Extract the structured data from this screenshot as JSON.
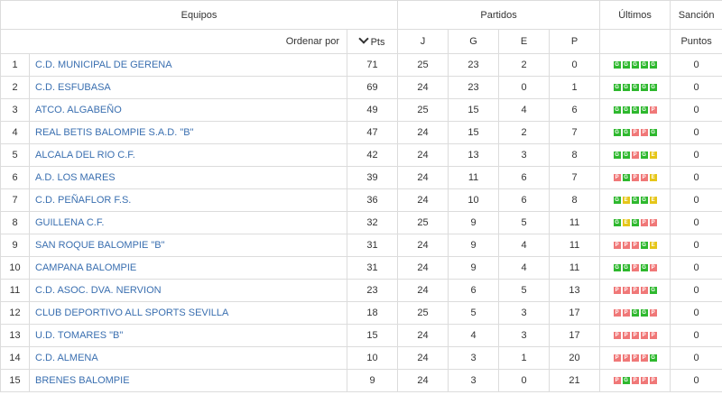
{
  "header": {
    "equipos": "Equipos",
    "partidos": "Partidos",
    "ultimos": "Últimos",
    "sancion": "Sanción",
    "ordenar_por": "Ordenar por",
    "pts": "Pts",
    "j": "J",
    "g": "G",
    "e": "E",
    "p": "P",
    "puntos": "Puntos"
  },
  "rows": [
    {
      "pos": "1",
      "team": "C.D. MUNICIPAL DE GERENA",
      "pts": "71",
      "j": "25",
      "g": "23",
      "e": "2",
      "p": "0",
      "last": [
        "G",
        "G",
        "G",
        "G",
        "G"
      ],
      "sancion": "0"
    },
    {
      "pos": "2",
      "team": "C.D. ESFUBASA",
      "pts": "69",
      "j": "24",
      "g": "23",
      "e": "0",
      "p": "1",
      "last": [
        "G",
        "G",
        "G",
        "G",
        "G"
      ],
      "sancion": "0"
    },
    {
      "pos": "3",
      "team": "ATCO. ALGABEÑO",
      "pts": "49",
      "j": "25",
      "g": "15",
      "e": "4",
      "p": "6",
      "last": [
        "G",
        "G",
        "G",
        "G",
        "P"
      ],
      "sancion": "0"
    },
    {
      "pos": "4",
      "team": "REAL BETIS BALOMPIE S.A.D. \"B\"",
      "pts": "47",
      "j": "24",
      "g": "15",
      "e": "2",
      "p": "7",
      "last": [
        "G",
        "G",
        "P",
        "P",
        "G"
      ],
      "sancion": "0"
    },
    {
      "pos": "5",
      "team": "ALCALA DEL RIO C.F.",
      "pts": "42",
      "j": "24",
      "g": "13",
      "e": "3",
      "p": "8",
      "last": [
        "G",
        "G",
        "P",
        "G",
        "E"
      ],
      "sancion": "0"
    },
    {
      "pos": "6",
      "team": "A.D. LOS MARES",
      "pts": "39",
      "j": "24",
      "g": "11",
      "e": "6",
      "p": "7",
      "last": [
        "P",
        "G",
        "P",
        "P",
        "E"
      ],
      "sancion": "0"
    },
    {
      "pos": "7",
      "team": "C.D. PEÑAFLOR F.S.",
      "pts": "36",
      "j": "24",
      "g": "10",
      "e": "6",
      "p": "8",
      "last": [
        "G",
        "E",
        "G",
        "G",
        "E"
      ],
      "sancion": "0"
    },
    {
      "pos": "8",
      "team": "GUILLENA C.F.",
      "pts": "32",
      "j": "25",
      "g": "9",
      "e": "5",
      "p": "11",
      "last": [
        "G",
        "E",
        "G",
        "P",
        "P"
      ],
      "sancion": "0"
    },
    {
      "pos": "9",
      "team": "SAN ROQUE BALOMPIE \"B\"",
      "pts": "31",
      "j": "24",
      "g": "9",
      "e": "4",
      "p": "11",
      "last": [
        "P",
        "P",
        "P",
        "G",
        "E"
      ],
      "sancion": "0"
    },
    {
      "pos": "10",
      "team": "CAMPANA BALOMPIE",
      "pts": "31",
      "j": "24",
      "g": "9",
      "e": "4",
      "p": "11",
      "last": [
        "G",
        "G",
        "P",
        "G",
        "P"
      ],
      "sancion": "0"
    },
    {
      "pos": "11",
      "team": "C.D. ASOC. DVA. NERVION",
      "pts": "23",
      "j": "24",
      "g": "6",
      "e": "5",
      "p": "13",
      "last": [
        "P",
        "P",
        "P",
        "P",
        "G"
      ],
      "sancion": "0"
    },
    {
      "pos": "12",
      "team": "CLUB DEPORTIVO ALL SPORTS SEVILLA",
      "pts": "18",
      "j": "25",
      "g": "5",
      "e": "3",
      "p": "17",
      "last": [
        "P",
        "P",
        "G",
        "G",
        "P"
      ],
      "sancion": "0"
    },
    {
      "pos": "13",
      "team": "U.D. TOMARES \"B\"",
      "pts": "15",
      "j": "24",
      "g": "4",
      "e": "3",
      "p": "17",
      "last": [
        "P",
        "P",
        "P",
        "P",
        "P"
      ],
      "sancion": "0"
    },
    {
      "pos": "14",
      "team": "C.D. ALMENA",
      "pts": "10",
      "j": "24",
      "g": "3",
      "e": "1",
      "p": "20",
      "last": [
        "P",
        "P",
        "P",
        "P",
        "G"
      ],
      "sancion": "0"
    },
    {
      "pos": "15",
      "team": "BRENES BALOMPIE",
      "pts": "9",
      "j": "24",
      "g": "3",
      "e": "0",
      "p": "21",
      "last": [
        "P",
        "G",
        "P",
        "P",
        "P"
      ],
      "sancion": "0"
    }
  ],
  "colors": {
    "win": "#2eb82e",
    "draw": "#e6c619",
    "loss": "#f07878",
    "link": "#3a6fb0"
  }
}
